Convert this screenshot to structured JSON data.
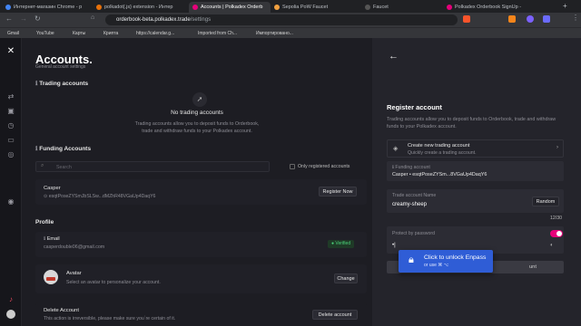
{
  "tabs": [
    {
      "label": "Интернет-магазин Chrome - p",
      "color": "#4285f4"
    },
    {
      "label": "polkadot{.js} extension - Интер",
      "color": "#e8710a"
    },
    {
      "label": "Accounts | Polkadex Orderb",
      "color": "#e6007a"
    },
    {
      "label": "Sepolia PoW Faucet",
      "color": "#f0a040"
    },
    {
      "label": "Faucet",
      "color": "#555555"
    },
    {
      "label": "Polkadex Orderbook SignUp - ",
      "color": "#e6007a"
    }
  ],
  "url": {
    "host": "orderbook-beta.polkadex.trade",
    "path": "/settings"
  },
  "bookmarks": [
    "Gmail",
    "YouTube",
    "Карты",
    "Криптa",
    "https://calendar.g...",
    "Imported from Ch...",
    "Импортировано..."
  ],
  "page": {
    "title": "Accounts.",
    "subtitle": "General account settings"
  },
  "trading": {
    "heading": "Trading accounts",
    "empty_title": "No trading accounts",
    "empty_text1": "Trading accounts allow you to deposit funds to Orderbook,",
    "empty_text2": "trade and withdraw funds to your Polkadex account."
  },
  "funding": {
    "heading": "Funding Accounts",
    "search_placeholder": "Search",
    "only_registered": "Only registered accounts",
    "account_name": "Casper",
    "account_addr": "esqtPoseZYSmJbSLSw...dMZhR48VGaUp4DaqY6",
    "register_button": "Register Now"
  },
  "profile": {
    "heading": "Profile",
    "email_label": "Email",
    "email_value": "casperdouble06@gmail.com",
    "verified": "Verified",
    "avatar_label": "Avatar",
    "avatar_desc": "Select an avatar to personalize your account.",
    "change_button": "Change",
    "delete_label": "Delete Account",
    "delete_desc": "This action is irreversible, please make sure you`re certain of it.",
    "delete_button": "Delete account"
  },
  "register": {
    "title": "Register account",
    "desc": "Trading accounts allow you to deposit funds to Orderbook, trade and withdraw funds to your Polkadex account.",
    "create_title": "Create new trading account",
    "create_sub": "Quickly create a trading account.",
    "funding_label": "Funding account",
    "funding_value": "Casper • esqtPoseZYSm...8VGaUp4DaqY6",
    "name_label": "Trade account Name",
    "name_value": "creamy-sheep",
    "random_button": "Random",
    "counter": "12/30",
    "protect_label": "Protect by password",
    "password_value": "•|",
    "submit": "unt"
  },
  "enpass": {
    "title": "Click to unlock Enpass",
    "sub": "or use ⌘ ⌥",
    "accent": "#2f5dd6"
  }
}
